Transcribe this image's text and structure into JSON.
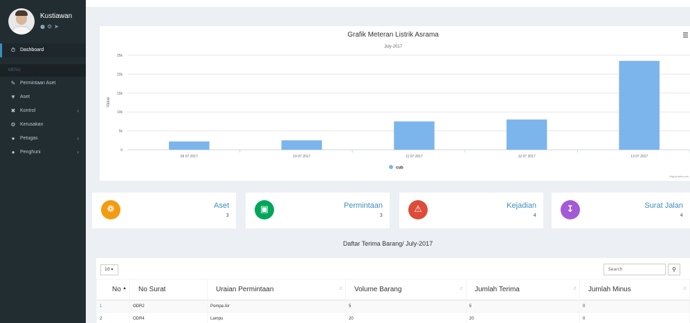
{
  "user": {
    "name": "Kustiawan",
    "icons": [
      "user-icon",
      "gear-icon",
      "sign-out-icon"
    ]
  },
  "sidebar": {
    "dashboard": "Dashboard",
    "menu_header": "MENU",
    "items": [
      {
        "label": "Permintaan Aset",
        "icon": "pencil-icon",
        "chevron": false
      },
      {
        "label": "Aset",
        "icon": "glass-icon",
        "chevron": false
      },
      {
        "label": "Kontrol",
        "icon": "wrench-icon",
        "chevron": true
      },
      {
        "label": "Kerusakan",
        "icon": "gears-icon",
        "chevron": false
      },
      {
        "label": "Petugas",
        "icon": "user-icon",
        "chevron": true
      },
      {
        "label": "Penghuni",
        "icon": "user-icon",
        "chevron": true
      }
    ]
  },
  "chart_data": {
    "type": "bar",
    "title": "Grafik Meteran Listrik Asrama",
    "subtitle": "July-2017",
    "ylabel": "Value",
    "categories": [
      "09 07 2017",
      "10 07 2017",
      "11 07 2017",
      "12 07 2017",
      "13 07 2017"
    ],
    "series": [
      {
        "name": "cub",
        "values": [
          2200,
          2500,
          7500,
          8000,
          23500
        ]
      }
    ],
    "ylim": [
      0,
      25000
    ],
    "yticks": [
      "0",
      "5k",
      "10k",
      "15k",
      "20k",
      "25k"
    ],
    "credit": "Highcharts.com",
    "color": "#7cb5ec",
    "grid": true,
    "legend": "bottom-center"
  },
  "stats": [
    {
      "label": "Aset",
      "count": "3",
      "color": "#f39c12",
      "icon": "cubes-icon"
    },
    {
      "label": "Permintaan",
      "count": "3",
      "color": "#00a65a",
      "icon": "cart-icon"
    },
    {
      "label": "Kejadian",
      "count": "4",
      "color": "#dd4b39",
      "icon": "warning-icon"
    },
    {
      "label": "Surat Jalan",
      "count": "4",
      "color": "#a35ad6",
      "icon": "download-icon"
    }
  ],
  "table": {
    "title": "Daftar Terima Barang/ July-2017",
    "length": "10",
    "search_placeholder": "Search",
    "headers": [
      "No",
      "No Surat",
      "Uraian Permintaan",
      "Volume Barang",
      "Jumlah Terima",
      "Jumlah Minus"
    ],
    "rows": [
      [
        "1",
        "ODR2",
        "Pompa Air",
        "5",
        "5",
        "0"
      ],
      [
        "2",
        "ODR4",
        "Lampu",
        "20",
        "20",
        "0"
      ]
    ]
  }
}
